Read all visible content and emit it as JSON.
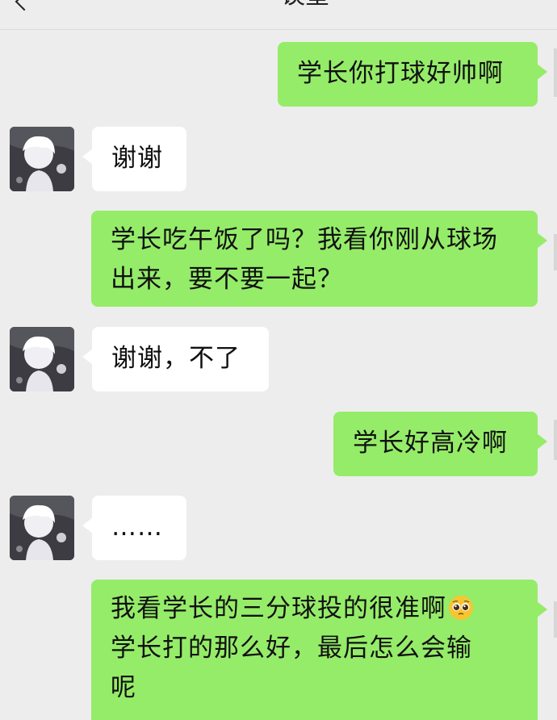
{
  "header": {
    "title_fragment": "谈皇"
  },
  "messages": [
    {
      "sender": "me",
      "lines": [
        "学长你打球好帅啊"
      ]
    },
    {
      "sender": "other",
      "lines": [
        "谢谢"
      ]
    },
    {
      "sender": "me",
      "lines": [
        "学长吃午饭了吗？我看你刚从球场",
        "出来，要不要一起？"
      ]
    },
    {
      "sender": "other",
      "lines": [
        "谢谢，不了"
      ]
    },
    {
      "sender": "me",
      "lines": [
        "学长好高冷啊"
      ]
    },
    {
      "sender": "other",
      "lines": [
        "……"
      ]
    },
    {
      "sender": "me",
      "lines": [
        "我看学长的三分球投的很准啊",
        "学长打的那么好，最后怎么会输",
        "呢"
      ],
      "emoji": "pleading-face"
    }
  ],
  "colors": {
    "background": "#ededed",
    "my_bubble": "#95ec69",
    "other_bubble": "#ffffff"
  }
}
